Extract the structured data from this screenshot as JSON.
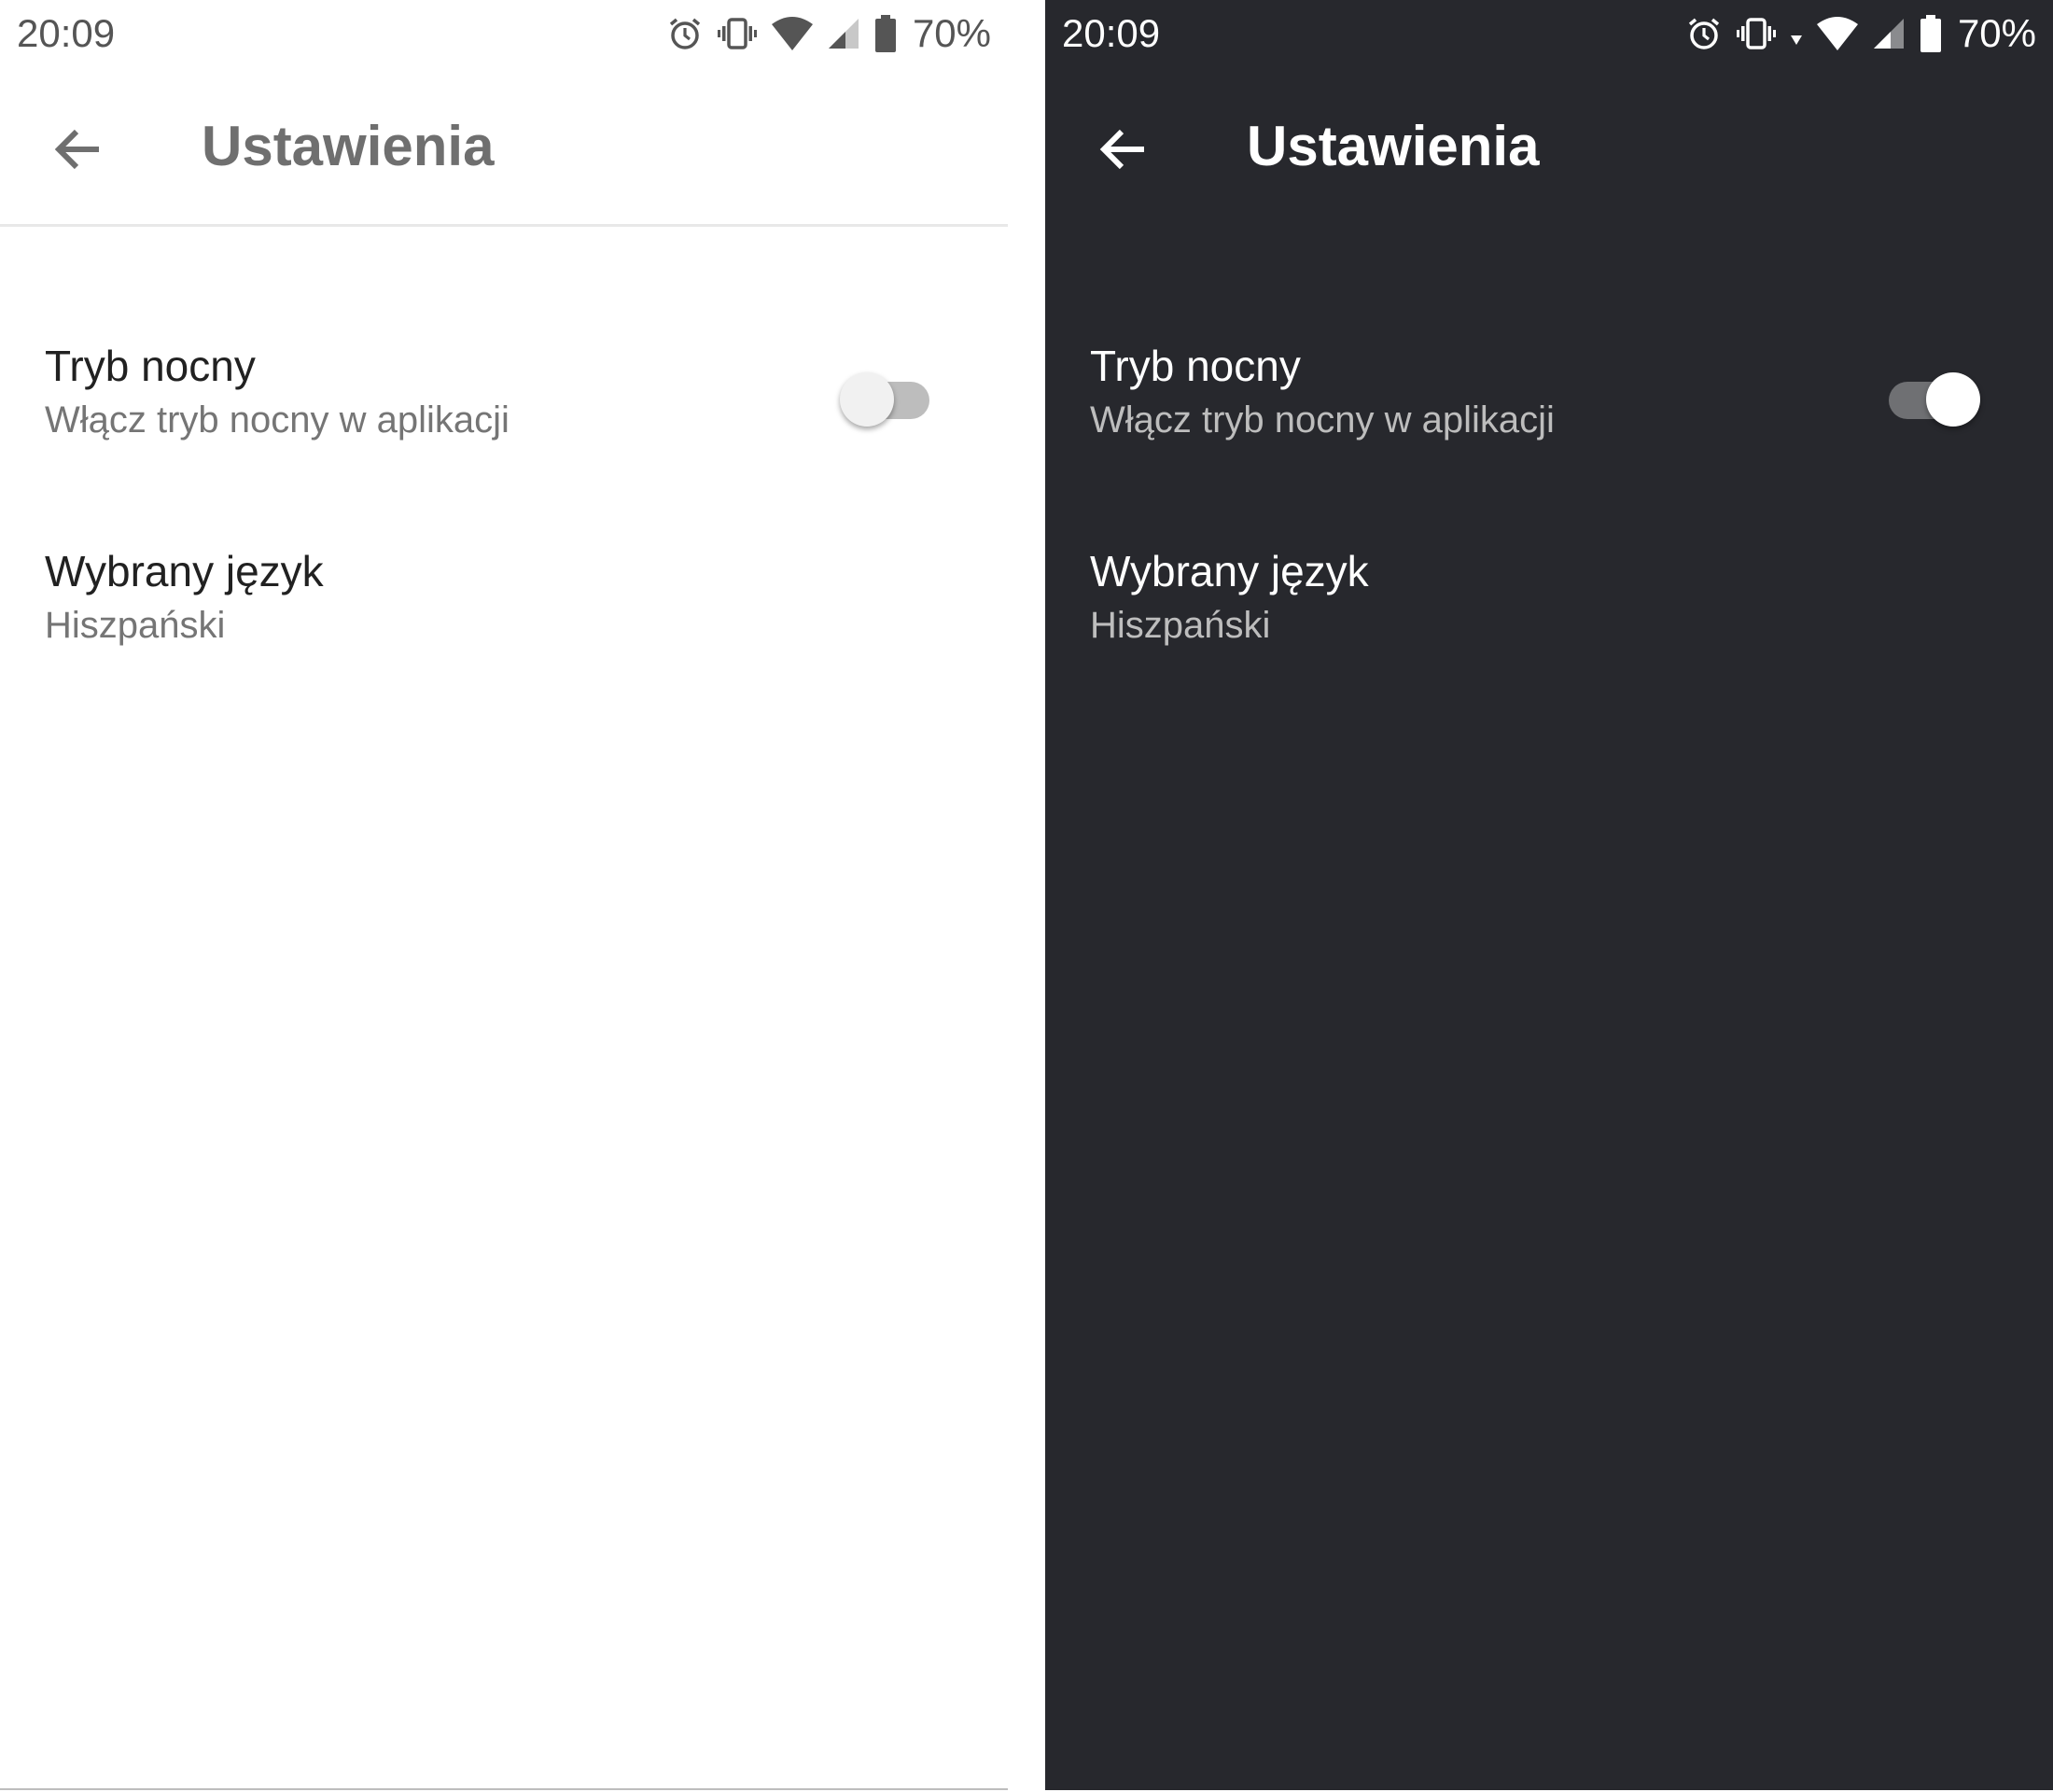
{
  "light": {
    "status_bar": {
      "time": "20:09",
      "battery_percent": "70%",
      "icons": [
        "alarm-icon",
        "vibrate-icon",
        "wifi-icon",
        "signal-icon",
        "battery-icon"
      ]
    },
    "app_bar": {
      "title": "Ustawienia",
      "back_icon": "arrow-back-icon"
    },
    "preferences": [
      {
        "title": "Tryb nocny",
        "summary": "Włącz tryb nocny w aplikacji",
        "toggle_on": false
      },
      {
        "title": "Wybrany język",
        "summary": "Hiszpański"
      }
    ]
  },
  "dark": {
    "status_bar": {
      "time": "20:09",
      "battery_percent": "70%",
      "icons": [
        "alarm-icon",
        "vibrate-icon",
        "data-arrow-icon",
        "wifi-icon",
        "signal-icon",
        "battery-icon"
      ]
    },
    "app_bar": {
      "title": "Ustawienia",
      "back_icon": "arrow-back-icon"
    },
    "preferences": [
      {
        "title": "Tryb nocny",
        "summary": "Włącz tryb nocny w aplikacji",
        "toggle_on": true
      },
      {
        "title": "Wybrany język",
        "summary": "Hiszpański"
      }
    ]
  },
  "colors": {
    "light_background": "#ffffff",
    "dark_background": "#27282d",
    "light_title": "#6f6f6f",
    "dark_title": "#ffffff",
    "summary_light": "#757575",
    "summary_dark": "#bdbdbd"
  }
}
